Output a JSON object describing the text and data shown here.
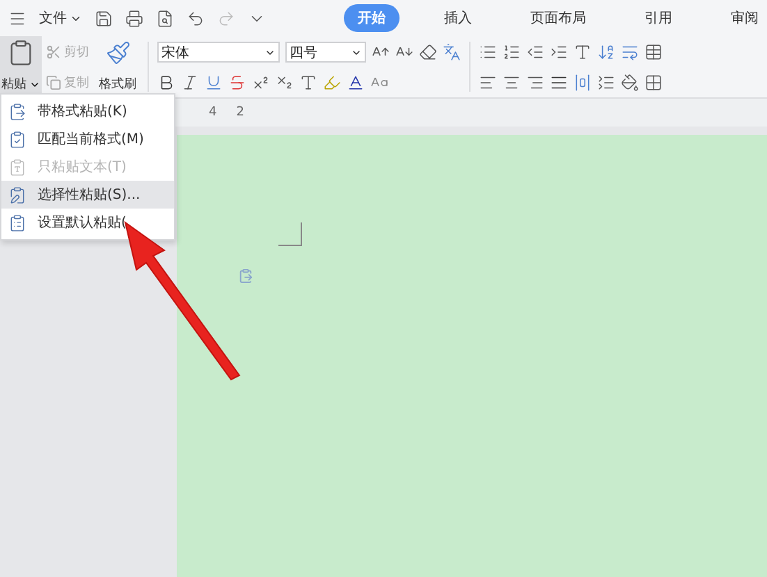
{
  "title_bar": {
    "file_menu": "文件"
  },
  "tabs": [
    {
      "label": "开始",
      "selected": true
    },
    {
      "label": "插入",
      "selected": false
    },
    {
      "label": "页面布局",
      "selected": false
    },
    {
      "label": "引用",
      "selected": false
    },
    {
      "label": "审阅",
      "selected": false
    }
  ],
  "clipboard": {
    "paste": "粘贴",
    "paste_open": true,
    "cut": {
      "label": "剪切",
      "disabled": true
    },
    "copy": {
      "label": "复制",
      "disabled": true
    },
    "format_painter": "格式刷"
  },
  "font": {
    "family": "宋体",
    "size": "四号"
  },
  "ruler": {
    "labels": [
      "4",
      "2"
    ]
  },
  "paste_menu": [
    {
      "label": "带格式粘贴(K)",
      "disabled": false,
      "selected": false
    },
    {
      "label": "匹配当前格式(M)",
      "disabled": false,
      "selected": false
    },
    {
      "label": "只粘贴文本(T)",
      "disabled": true,
      "selected": false
    },
    {
      "label": "选择性粘贴(S)...",
      "disabled": false,
      "selected": true
    },
    {
      "label": "设置默认粘贴(",
      "disabled": false,
      "selected": false
    }
  ]
}
